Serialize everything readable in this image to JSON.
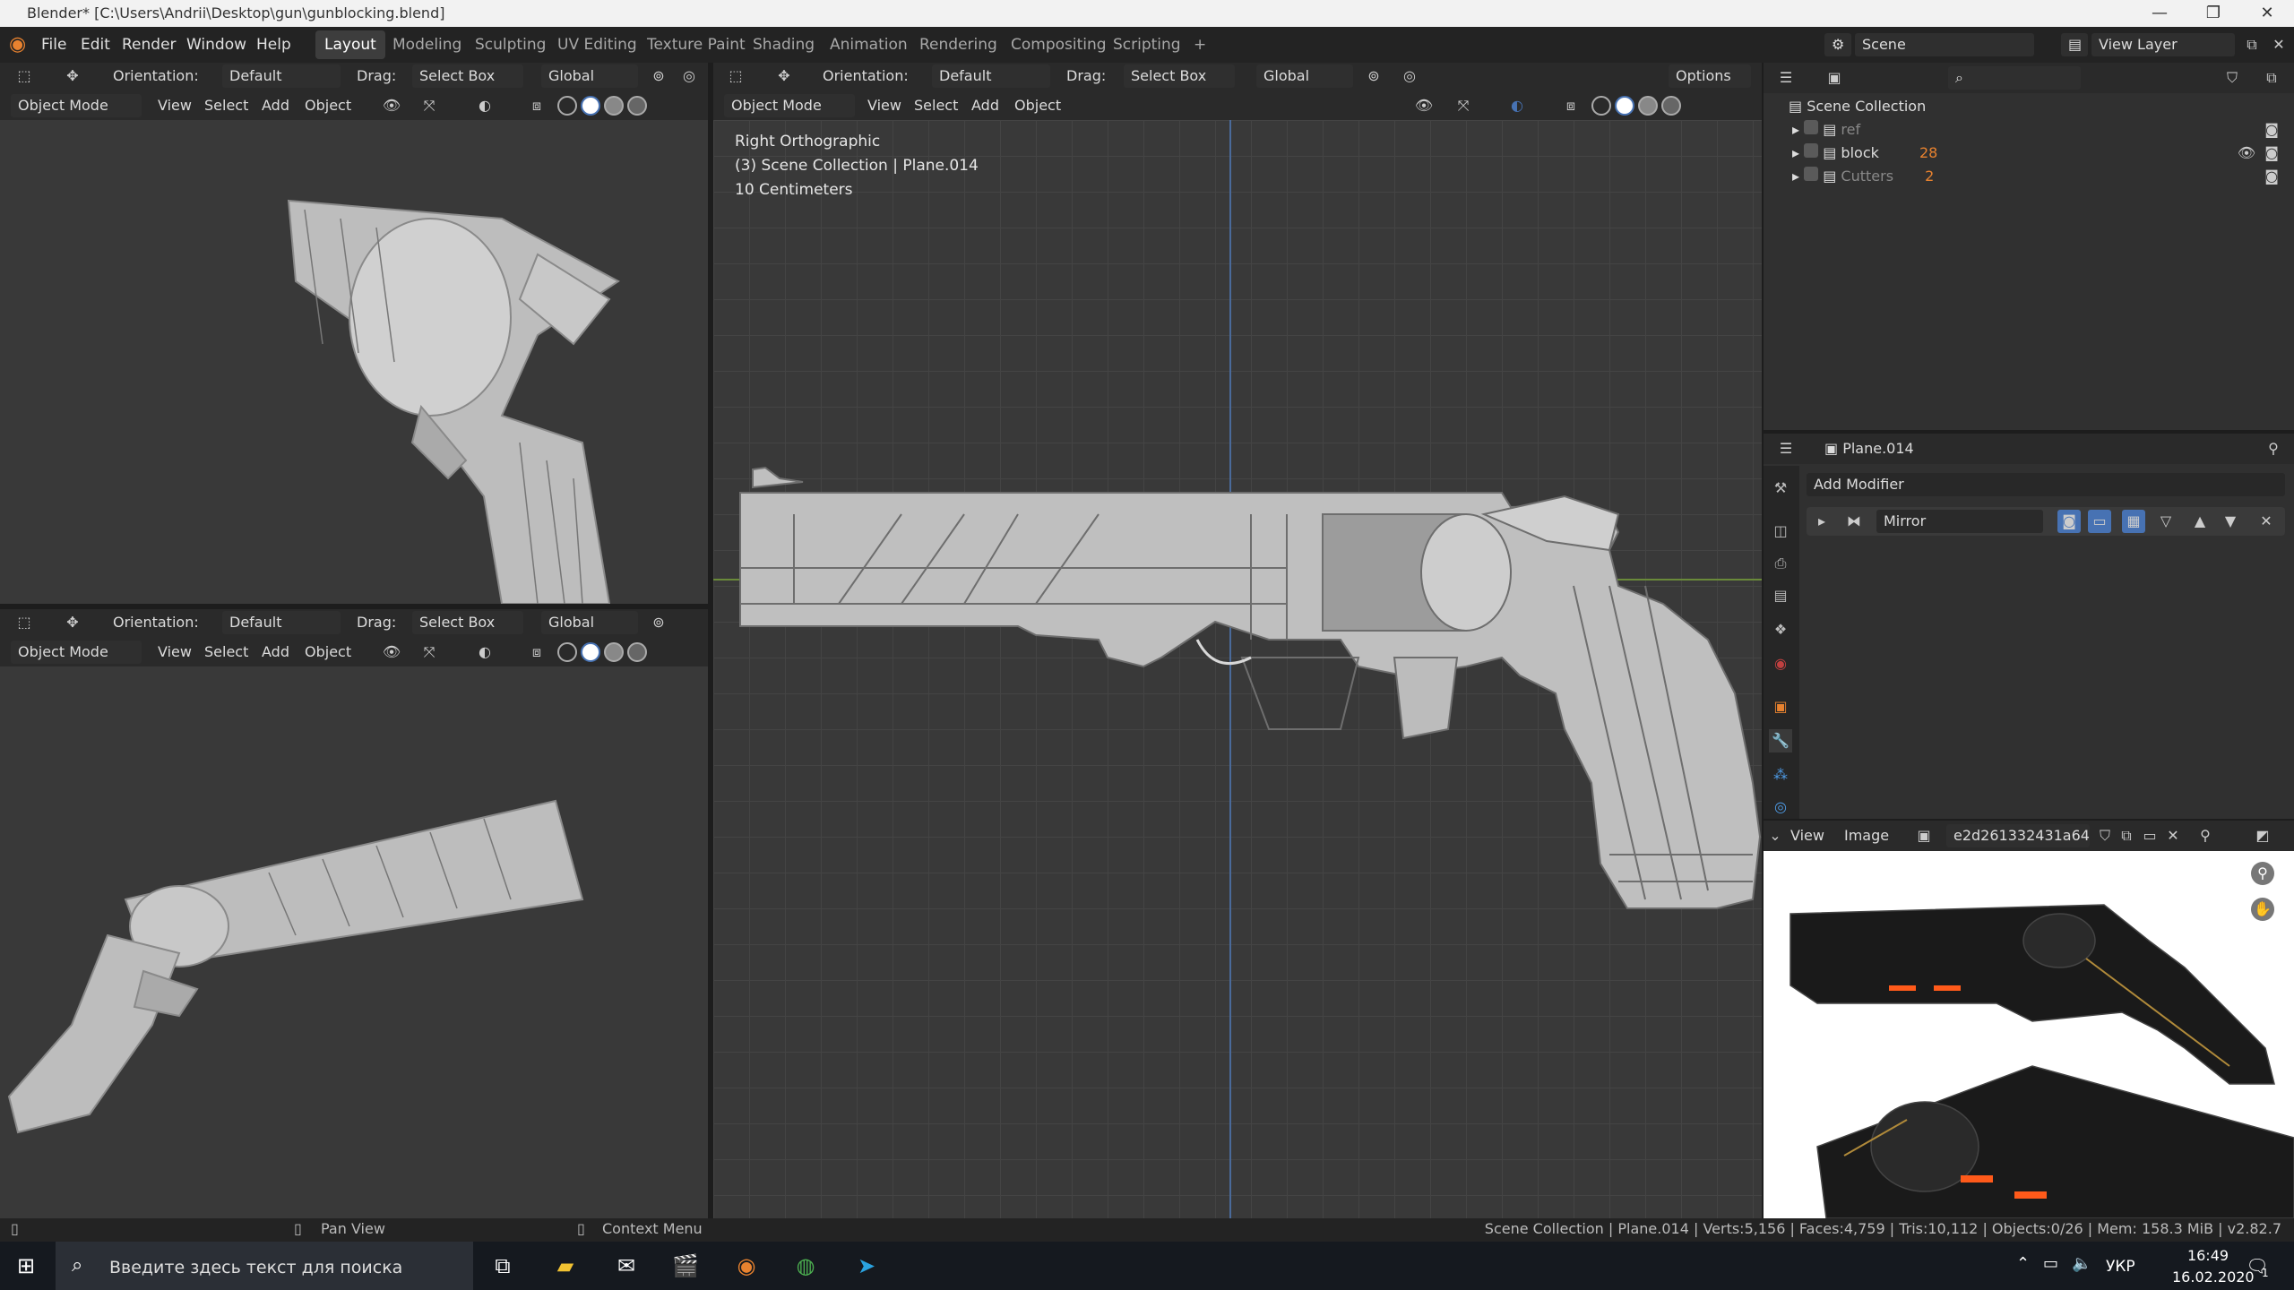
{
  "titlebar": {
    "title": "Blender* [C:\\Users\\Andrii\\Desktop\\gun\\gunblocking.blend]",
    "minimize": "—",
    "maximize": "❐",
    "close": "✕"
  },
  "menu": {
    "logo": "◉",
    "items": [
      "File",
      "Edit",
      "Render",
      "Window",
      "Help"
    ]
  },
  "workspaces": {
    "tabs": [
      "Layout",
      "Modeling",
      "Sculpting",
      "UV Editing",
      "Texture Paint",
      "Shading",
      "Animation",
      "Rendering",
      "Compositing",
      "Scripting"
    ],
    "add": "+",
    "active": "Layout"
  },
  "scene": {
    "label": "Scene",
    "view_layer": "View Layer"
  },
  "tool_header": {
    "orientation_label": "Orientation:",
    "orientation_value": "Default",
    "drag_label": "Drag:",
    "drag_value": "Select Box",
    "transform": "Global",
    "options": "Options"
  },
  "viewport_header": {
    "mode": "Object Mode",
    "view": "View",
    "select": "Select",
    "add": "Add",
    "object": "Object"
  },
  "main_viewport": {
    "line1": "Right Orthographic",
    "line2": "(3) Scene Collection | Plane.014",
    "line3": "10 Centimeters"
  },
  "outliner": {
    "root": "Scene Collection",
    "items": [
      {
        "name": "ref",
        "badge": ""
      },
      {
        "name": "block",
        "badge": "28"
      },
      {
        "name": "Cutters",
        "badge": "2"
      }
    ]
  },
  "properties": {
    "object_name": "Plane.014",
    "add_modifier": "Add Modifier",
    "modifier_name": "Mirror"
  },
  "image_editor": {
    "view": "View",
    "image": "Image",
    "image_name": "e2d261332431a64..."
  },
  "statusbar": {
    "pan": "Pan View",
    "context": "Context Menu",
    "stats": "Scene Collection | Plane.014 | Verts:5,156 | Faces:4,759 | Tris:10,112 | Objects:0/26 | Mem: 158.3 MiB | v2.82.7"
  },
  "taskbar": {
    "search_placeholder": "Введите здесь текст для поиска",
    "lang": "УКР",
    "time": "16:49",
    "date": "16.02.2020",
    "notif": "1"
  },
  "colors": {
    "accent": "#4772b3",
    "header": "#2a2a2a",
    "viewport": "#393939",
    "orange": "#e8822f"
  }
}
